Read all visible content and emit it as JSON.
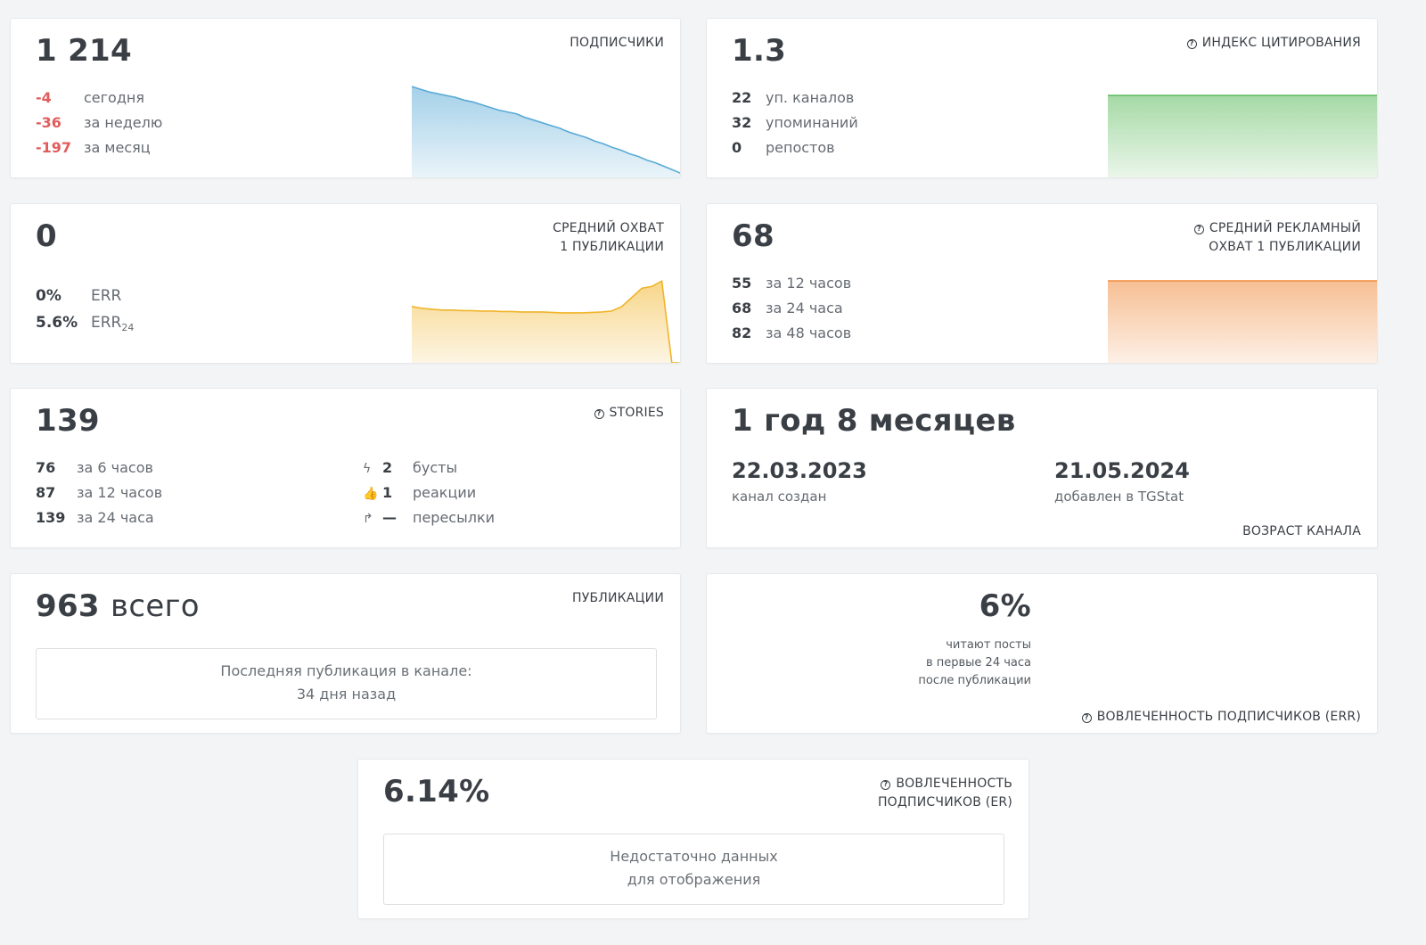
{
  "subscribers": {
    "value": "1 214",
    "label": "Подписчики",
    "rows": [
      {
        "value": "-4",
        "text": "сегодня"
      },
      {
        "value": "-36",
        "text": "за неделю"
      },
      {
        "value": "-197",
        "text": "за месяц"
      }
    ],
    "color": "#5aaad6",
    "trend": [
      100,
      97,
      94,
      92,
      90,
      88,
      85,
      83,
      80,
      77,
      74,
      72,
      70,
      66,
      63,
      60,
      57,
      54,
      50,
      47,
      44,
      40,
      37,
      33,
      30,
      26,
      23,
      19,
      16,
      12,
      8,
      4
    ]
  },
  "citation": {
    "value": "1.3",
    "label": "Индекс цитирования",
    "rows": [
      {
        "value": "22",
        "text": "уп. каналов"
      },
      {
        "value": "32",
        "text": "упоминаний"
      },
      {
        "value": "0",
        "text": "репостов"
      }
    ],
    "color": "#5cba5c"
  },
  "reach": {
    "value": "0",
    "label_line1": "Средний охват",
    "label_line2": "1 публикации",
    "rows": [
      {
        "value": "0%",
        "text": "ERR",
        "sub": ""
      },
      {
        "value": "5.6%",
        "text": "ERR",
        "sub": "24"
      }
    ],
    "color": "#f0b429",
    "trend": [
      62,
      60,
      59,
      58,
      58,
      57.5,
      57.5,
      57,
      57,
      56.5,
      56.5,
      56,
      56,
      56,
      55.5,
      55,
      55,
      55,
      55.5,
      56,
      57,
      62,
      72,
      82,
      84,
      90,
      0,
      0
    ]
  },
  "ad_reach": {
    "value": "68",
    "label_line1": "Средний рекламный",
    "label_line2": "охват 1 публикации",
    "rows": [
      {
        "value": "55",
        "text": "за 12 часов"
      },
      {
        "value": "68",
        "text": "за 24 часа"
      },
      {
        "value": "82",
        "text": "за 48 часов"
      }
    ],
    "color": "#f08a3c"
  },
  "stories": {
    "value": "139",
    "label": "Stories",
    "rows": [
      {
        "value": "76",
        "text": "за 6 часов"
      },
      {
        "value": "87",
        "text": "за 12 часов"
      },
      {
        "value": "139",
        "text": "за 24 часа"
      }
    ],
    "extra": [
      {
        "icon": "ϟ",
        "value": "2",
        "text": "бусты"
      },
      {
        "icon": "👍",
        "value": "1",
        "text": "реакции"
      },
      {
        "icon": "↱",
        "value": "—",
        "text": "пересылки"
      }
    ]
  },
  "age": {
    "value": "1 год 8 месяцев",
    "created_date": "22.03.2023",
    "created_text": "канал создан",
    "added_date": "21.05.2024",
    "added_text": "добавлен в TGStat",
    "label": "Возраст канала"
  },
  "posts": {
    "value": "963",
    "value_suffix": "всего",
    "label": "Публикации",
    "box_line1": "Последняя публикация в канале:",
    "box_line2": "34 дня назад"
  },
  "err": {
    "value": "6%",
    "line1": "читают посты",
    "line2": "в первые 24 часа",
    "line3": "после публикации",
    "label": "Вовлеченность подписчиков (ERR)"
  },
  "er": {
    "value": "6.14%",
    "label_line1": "Вовлеченность",
    "label_line2": "подписчиков (ER)",
    "box_line1": "Недостаточно данных",
    "box_line2": "для отображения"
  }
}
